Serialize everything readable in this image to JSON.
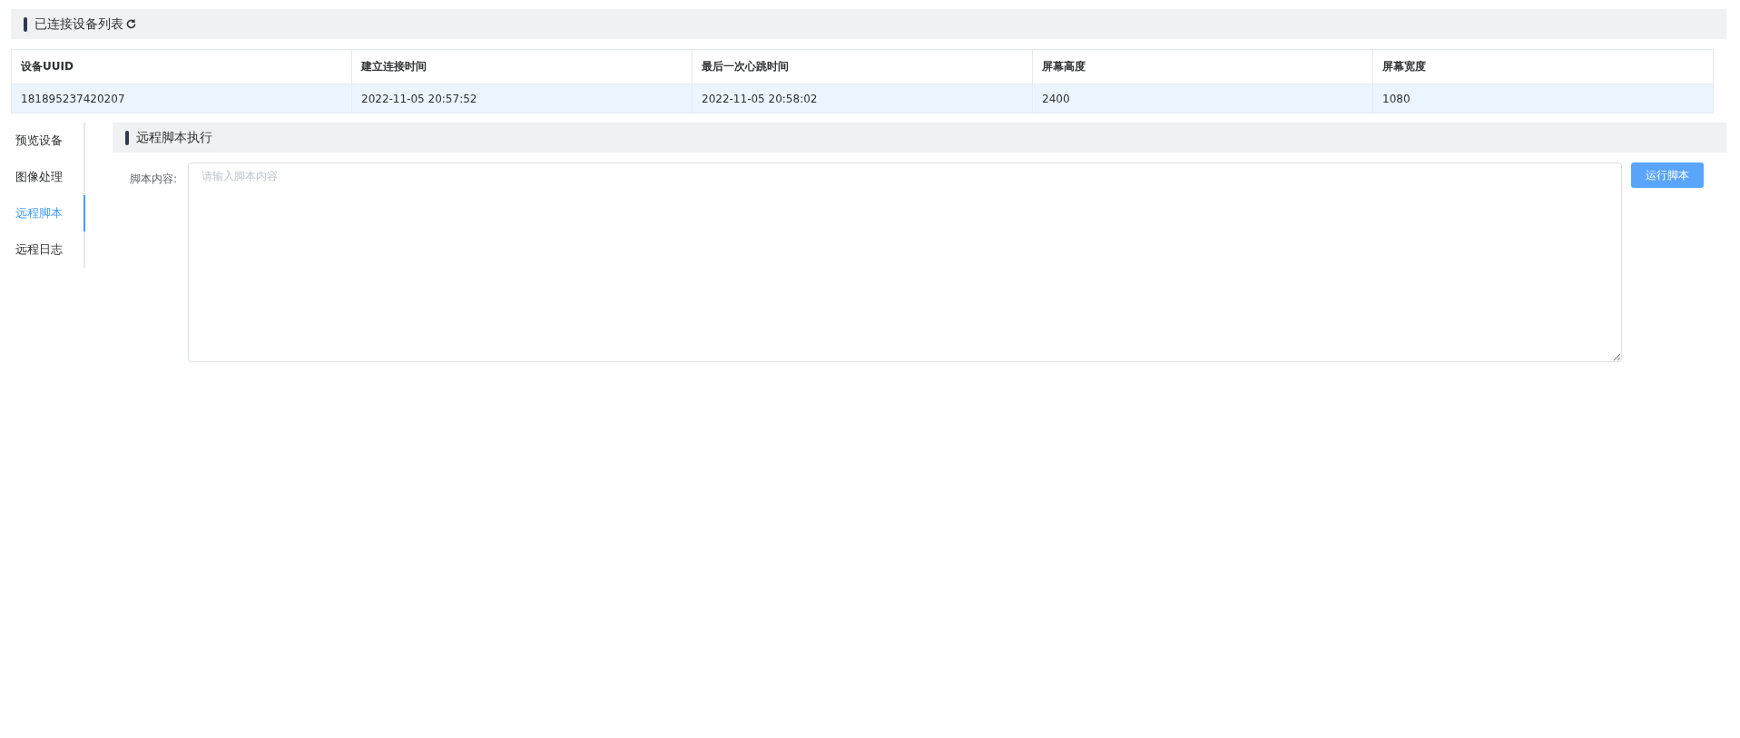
{
  "device_list": {
    "title": "已连接设备列表",
    "columns": [
      "设备UUID",
      "建立连接时间",
      "最后一次心跳时间",
      "屏幕高度",
      "屏幕宽度"
    ],
    "rows": [
      {
        "cells": [
          "181895237420207",
          "2022-11-05 20:57:52",
          "2022-11-05 20:58:02",
          "2400",
          "1080"
        ],
        "selected": true
      }
    ]
  },
  "side_tabs": [
    {
      "label": "预览设备",
      "selected": false
    },
    {
      "label": "图像处理",
      "selected": false
    },
    {
      "label": "远程脚本",
      "selected": true
    },
    {
      "label": "远程日志",
      "selected": false
    }
  ],
  "script_panel": {
    "title": "远程脚本执行",
    "field_label": "脚本内容:",
    "placeholder": "请输入脚本内容",
    "run_button": "运行脚本"
  }
}
